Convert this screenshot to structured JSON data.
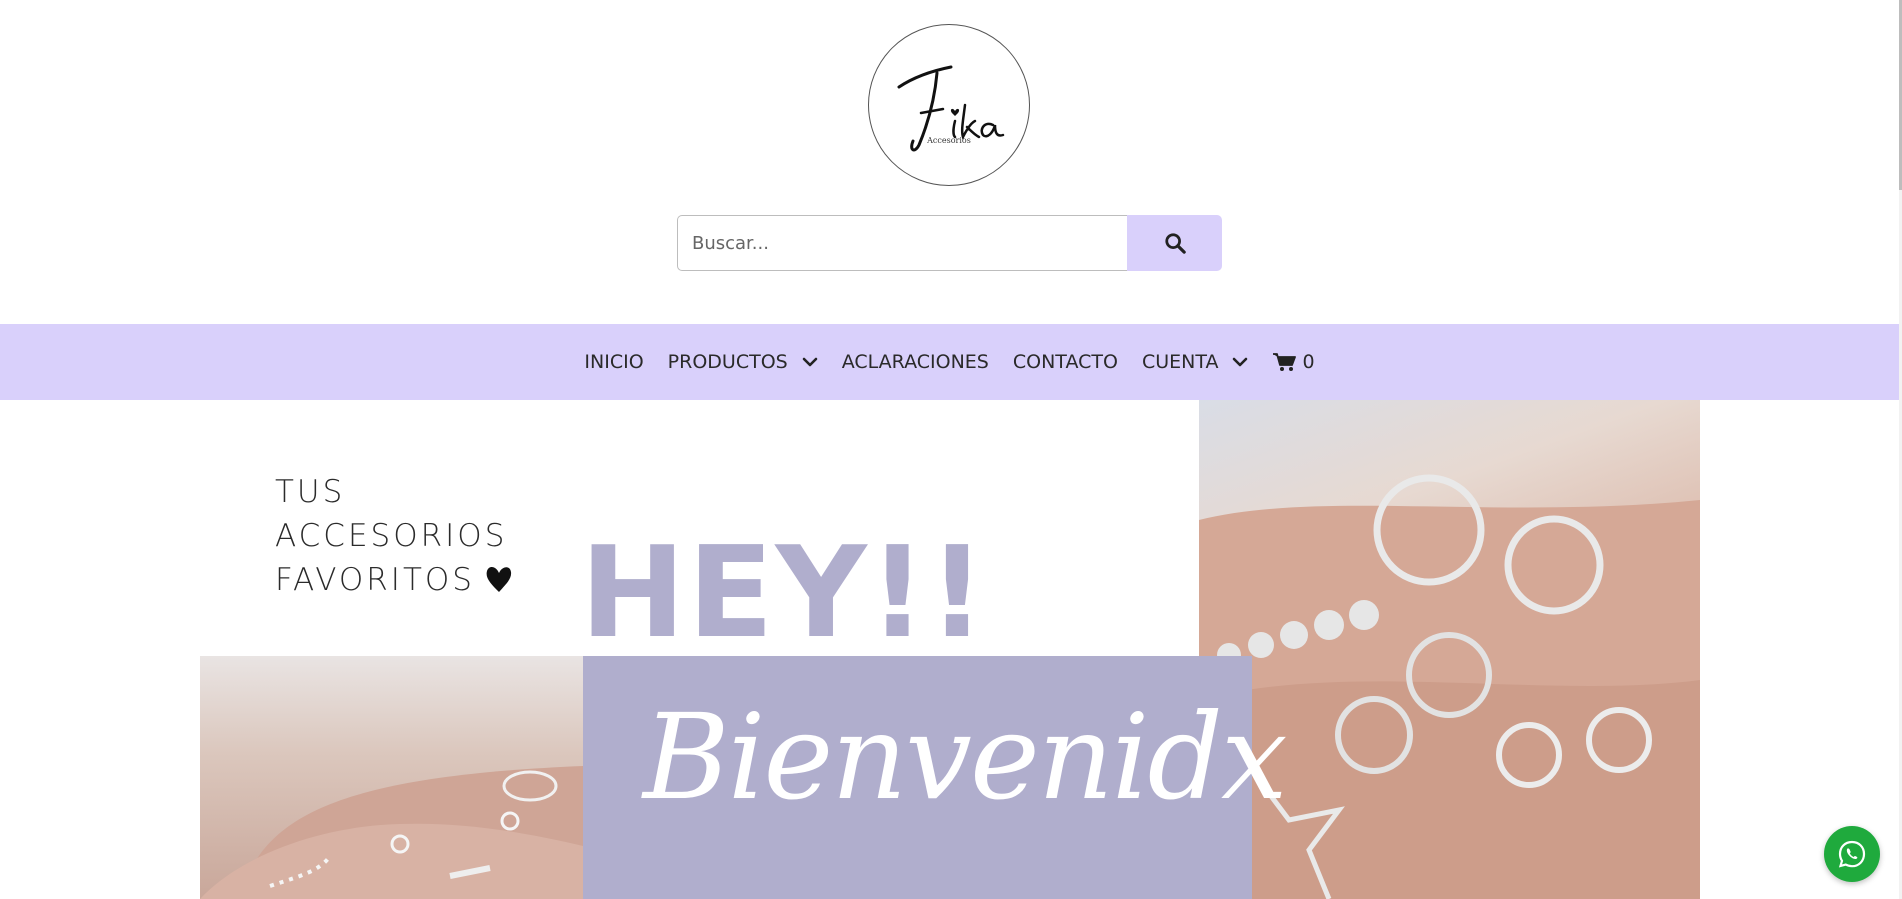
{
  "brand": {
    "logo_text": "Fika",
    "logo_subtext": "Accesorios"
  },
  "search": {
    "placeholder": "Buscar...",
    "button_icon": "search-icon"
  },
  "nav": {
    "items": [
      {
        "label": "INICIO",
        "dropdown": false
      },
      {
        "label": "PRODUCTOS",
        "dropdown": true
      },
      {
        "label": "ACLARACIONES",
        "dropdown": false
      },
      {
        "label": "CONTACTO",
        "dropdown": false
      },
      {
        "label": "CUENTA",
        "dropdown": true
      }
    ],
    "cart": {
      "icon": "cart-icon",
      "count": "0"
    }
  },
  "hero": {
    "tagline": [
      "TUS",
      "ACCESORIOS",
      "FAVORITOS"
    ],
    "hey": "HEY!!",
    "welcome": "Bienvenidx"
  },
  "whatsapp": {
    "icon": "whatsapp-icon"
  },
  "colors": {
    "nav_bg": "#d9d0fb",
    "accent": "#b0aecd",
    "whatsapp": "#1faa3d"
  }
}
